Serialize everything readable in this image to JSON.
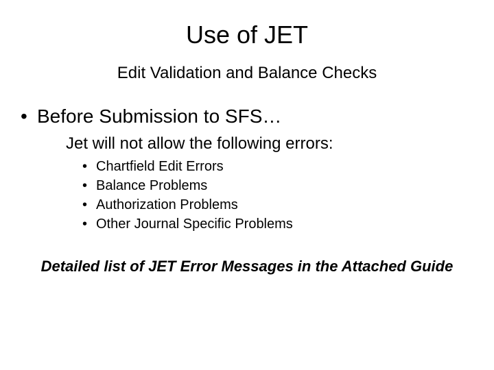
{
  "title": "Use of JET",
  "subtitle": "Edit Validation and Balance Checks",
  "body": {
    "heading": "Before Submission to SFS…",
    "subheading": "Jet will not allow the following errors:",
    "items": [
      "Chartfield Edit Errors",
      "Balance Problems",
      "Authorization Problems",
      "Other Journal Specific Problems"
    ]
  },
  "footer": "Detailed list of JET Error Messages in the Attached Guide"
}
